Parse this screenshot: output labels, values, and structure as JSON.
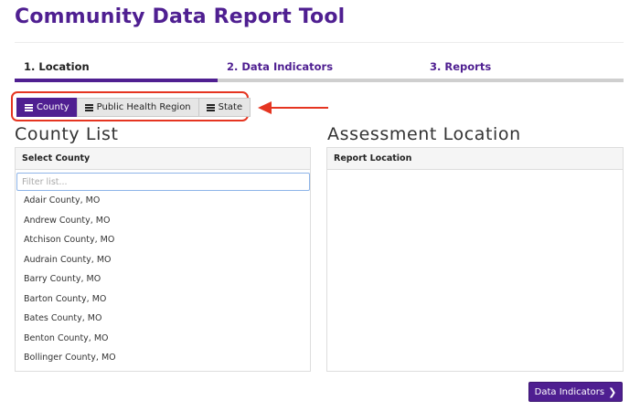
{
  "page": {
    "title": "Community Data Report Tool"
  },
  "steps": [
    {
      "label": "1. Location",
      "active": true
    },
    {
      "label": "2. Data Indicators",
      "active": false
    },
    {
      "label": "3. Reports",
      "active": false
    }
  ],
  "geography_toggle": {
    "county": "County",
    "region": "Public Health Region",
    "state": "State",
    "selected": "County",
    "icon": "list-icon"
  },
  "annotation": {
    "color": "#e53521"
  },
  "colors": {
    "brand": "#4f1f91",
    "annotation_red": "#e53521"
  },
  "county_section": {
    "heading": "County List",
    "panel_header": "Select County",
    "filter": {
      "placeholder": "Filter list...",
      "value": ""
    },
    "items": [
      "Adair County, MO",
      "Andrew County, MO",
      "Atchison County, MO",
      "Audrain County, MO",
      "Barry County, MO",
      "Barton County, MO",
      "Bates County, MO",
      "Benton County, MO",
      "Bollinger County, MO"
    ]
  },
  "assessment_section": {
    "heading": "Assessment Location",
    "panel_header": "Report Location"
  },
  "footer": {
    "next_label": "Data Indicators",
    "next_icon": "chevron-right-icon"
  }
}
